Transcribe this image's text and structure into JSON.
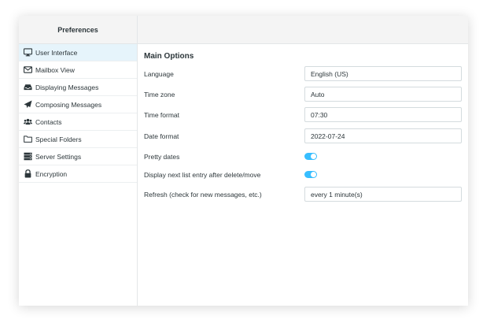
{
  "sidebar": {
    "title": "Preferences",
    "items": [
      {
        "label": "User Interface",
        "icon": "monitor-icon",
        "selected": true
      },
      {
        "label": "Mailbox View",
        "icon": "envelope-icon",
        "selected": false
      },
      {
        "label": "Displaying Messages",
        "icon": "inbox-tray-icon",
        "selected": false
      },
      {
        "label": "Composing Messages",
        "icon": "paper-plane-icon",
        "selected": false
      },
      {
        "label": "Contacts",
        "icon": "users-icon",
        "selected": false
      },
      {
        "label": "Special Folders",
        "icon": "folder-icon",
        "selected": false
      },
      {
        "label": "Server Settings",
        "icon": "server-icon",
        "selected": false
      },
      {
        "label": "Encryption",
        "icon": "lock-icon",
        "selected": false
      }
    ]
  },
  "main": {
    "section_title": "Main Options",
    "options": {
      "language": {
        "label": "Language",
        "value": "English (US)"
      },
      "timezone": {
        "label": "Time zone",
        "value": "Auto"
      },
      "time_format": {
        "label": "Time format",
        "value": "07:30"
      },
      "date_format": {
        "label": "Date format",
        "value": "2022-07-24"
      },
      "pretty_dates": {
        "label": "Pretty dates",
        "enabled": true
      },
      "display_next": {
        "label": "Display next list entry after delete/move",
        "enabled": true
      },
      "refresh": {
        "label": "Refresh (check for new messages, etc.)",
        "value": "every 1 minute(s)"
      }
    }
  },
  "colors": {
    "accent": "#37beff",
    "selected_bg": "#e6f4fb",
    "header_bg": "#f4f4f4",
    "text": "#2c363a"
  }
}
